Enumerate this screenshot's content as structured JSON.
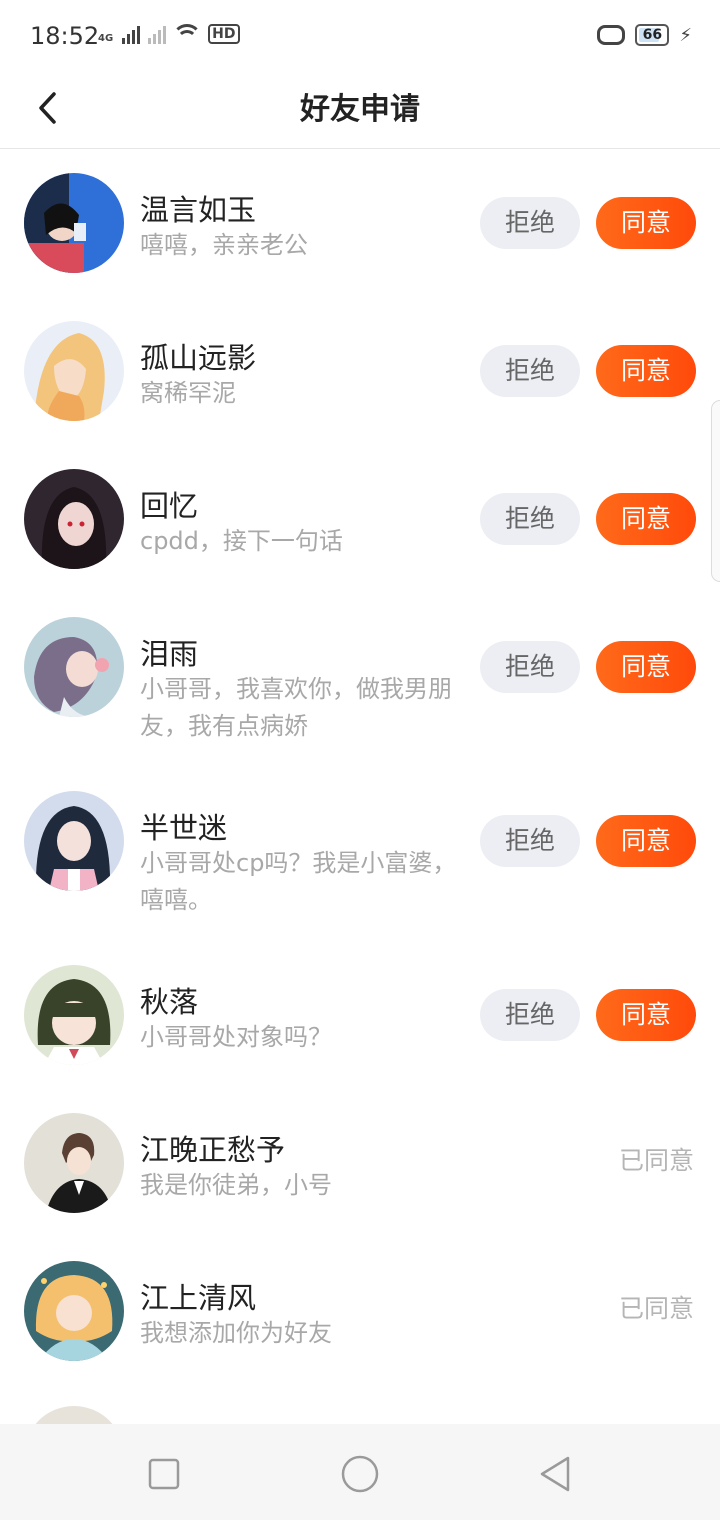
{
  "status_bar": {
    "time": "18:52",
    "network": "4G",
    "hd_label": "HD",
    "battery_level": "66"
  },
  "header": {
    "title": "好友申请",
    "back_icon": "chevron-left-icon"
  },
  "requests": [
    {
      "name": "温言如玉",
      "message": "嘻嘻，亲亲老公",
      "status": "pending",
      "reject_label": "拒绝",
      "accept_label": "同意",
      "avatar_color": "#2f6fd8"
    },
    {
      "name": "孤山远影",
      "message": "窝稀罕泥",
      "status": "pending",
      "reject_label": "拒绝",
      "accept_label": "同意",
      "avatar_color": "#f2c27a"
    },
    {
      "name": "回忆",
      "message": "cpdd，接下一句话",
      "status": "pending",
      "reject_label": "拒绝",
      "accept_label": "同意",
      "avatar_color": "#3b2f3a"
    },
    {
      "name": "泪雨",
      "message": "小哥哥，我喜欢你，做我男朋友，我有点病娇",
      "status": "pending",
      "reject_label": "拒绝",
      "accept_label": "同意",
      "avatar_color": "#b9cfd8"
    },
    {
      "name": "半世迷",
      "message": "小哥哥处cp吗？我是小富婆，嘻嘻。",
      "status": "pending",
      "reject_label": "拒绝",
      "accept_label": "同意",
      "avatar_color": "#c8d3e8"
    },
    {
      "name": "秋落",
      "message": "小哥哥处对象吗？",
      "status": "pending",
      "reject_label": "拒绝",
      "accept_label": "同意",
      "avatar_color": "#3e4a2e"
    },
    {
      "name": "江晚正愁予",
      "message": "我是你徒弟，小号",
      "status": "accepted",
      "accepted_label": "已同意",
      "avatar_color": "#e0dcd4"
    },
    {
      "name": "江上清风",
      "message": "我想添加你为好友",
      "status": "accepted",
      "accepted_label": "已同意",
      "avatar_color": "#f0c27a"
    }
  ],
  "nav_bar": {
    "recent_icon": "square-icon",
    "home_icon": "circle-icon",
    "back_icon": "triangle-back-icon"
  },
  "colors": {
    "accent": "#ff5a10",
    "reject_bg": "#eceef3",
    "secondary_text": "#a8a8a8"
  }
}
